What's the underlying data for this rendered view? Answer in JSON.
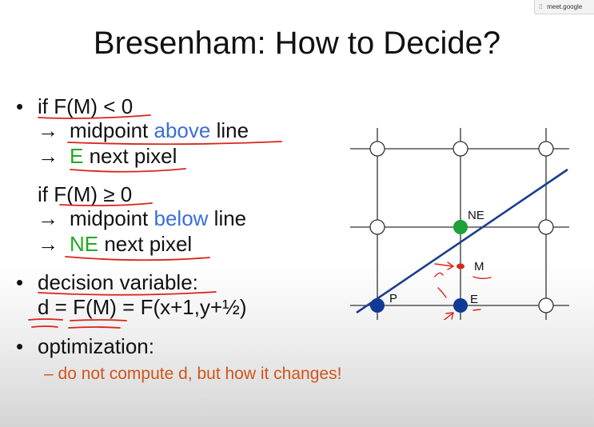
{
  "browser_chip": {
    "text": "meet.google",
    "icon": "tab-icon"
  },
  "slide": {
    "title": "Bresenham: How to Decide?",
    "bullet1": {
      "if_text": "if F(M) < 0",
      "arrow1_pre": "midpoint ",
      "arrow1_word": "above",
      "arrow1_post": " line",
      "arrow2_word": "E",
      "arrow2_post": " next pixel"
    },
    "bullet1b": {
      "if_text": "if F(M) ≥ 0",
      "arrow1_pre": "midpoint ",
      "arrow1_word": "below",
      "arrow1_post": " line",
      "arrow2_word": "NE",
      "arrow2_post": " next pixel"
    },
    "arrow_glyph": "→",
    "bullet_glyph": "•",
    "bullet2": {
      "label": "decision variable:",
      "formula": "d = F(M) = F(x+1,y+½)"
    },
    "bullet3": {
      "label": "optimization:",
      "sub": "– do not compute d, but how it changes!"
    },
    "diagram": {
      "labels": {
        "p": "P",
        "e": "E",
        "ne": "NE",
        "m": "M"
      }
    }
  },
  "colors": {
    "accent_blue": "#3a6fd8",
    "accent_green": "#1faa1f",
    "sub_orange": "#d2541a",
    "line_navy": "#1a3e8c",
    "pixel_blue": "#0f3a96",
    "pixel_green": "#1fa03a",
    "midpoint_red": "#d62b1a",
    "annotation_red": "#d8231a"
  }
}
